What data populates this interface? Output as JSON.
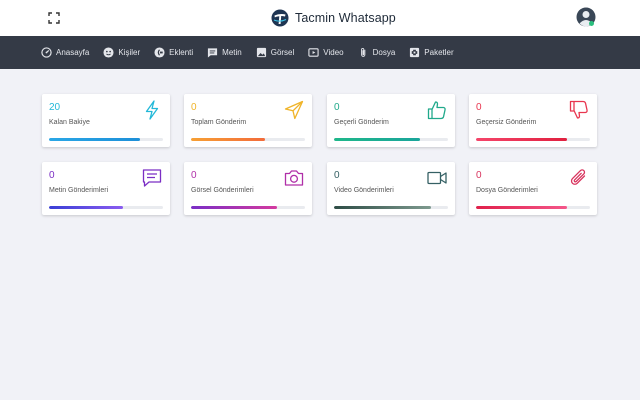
{
  "header": {
    "title": "Tacmin Whatsapp",
    "fullscreen_icon": "fullscreen-icon",
    "avatar_icon": "user-avatar-icon",
    "logo_icon": "tacmin-logo-icon"
  },
  "nav": {
    "items": [
      {
        "label": "Anasayfa",
        "icon": "dashboard-icon"
      },
      {
        "label": "Kişiler",
        "icon": "contacts-icon"
      },
      {
        "label": "Eklenti",
        "icon": "extension-icon"
      },
      {
        "label": "Metin",
        "icon": "message-icon"
      },
      {
        "label": "Görsel",
        "icon": "image-icon"
      },
      {
        "label": "Video",
        "icon": "video-icon"
      },
      {
        "label": "Dosya",
        "icon": "attachment-icon"
      },
      {
        "label": "Paketler",
        "icon": "packages-icon"
      }
    ]
  },
  "cards": [
    {
      "value": "20",
      "label": "Kalan Bakiye",
      "icon": "lightning-icon",
      "color": "#22b8d8",
      "fill": 0.8,
      "gradient": [
        "#2aa7e6",
        "#1d8fd8"
      ]
    },
    {
      "value": "0",
      "label": "Toplam Gönderim",
      "icon": "send-icon",
      "color": "#f0b429",
      "fill": 0.65,
      "gradient": [
        "#f7a034",
        "#f26b3a"
      ]
    },
    {
      "value": "0",
      "label": "Geçerli Gönderim",
      "icon": "thumbs-up-icon",
      "color": "#20a98b",
      "fill": 0.75,
      "gradient": [
        "#1fb78a",
        "#1aa59b"
      ]
    },
    {
      "value": "0",
      "label": "Geçersiz Gönderim",
      "icon": "thumbs-down-icon",
      "color": "#e8364f",
      "fill": 0.8,
      "gradient": [
        "#f5456a",
        "#e0203f"
      ]
    },
    {
      "value": "0",
      "label": "Metin Gönderimleri",
      "icon": "chat-icon",
      "color": "#7b2ec4",
      "fill": 0.65,
      "gradient": [
        "#3a3fd6",
        "#8a5cf0"
      ]
    },
    {
      "value": "0",
      "label": "Görsel Gönderimleri",
      "icon": "camera-icon",
      "color": "#b02fa8",
      "fill": 0.75,
      "gradient": [
        "#7a2ec6",
        "#d43a9f"
      ]
    },
    {
      "value": "0",
      "label": "Video Gönderimleri",
      "icon": "video-camera-icon",
      "color": "#356064",
      "fill": 0.85,
      "gradient": [
        "#2e4d46",
        "#7e9a8f"
      ]
    },
    {
      "value": "0",
      "label": "Dosya Gönderimleri",
      "icon": "paperclip-icon",
      "color": "#d8345e",
      "fill": 0.8,
      "gradient": [
        "#e0204a",
        "#f4578a"
      ]
    }
  ]
}
